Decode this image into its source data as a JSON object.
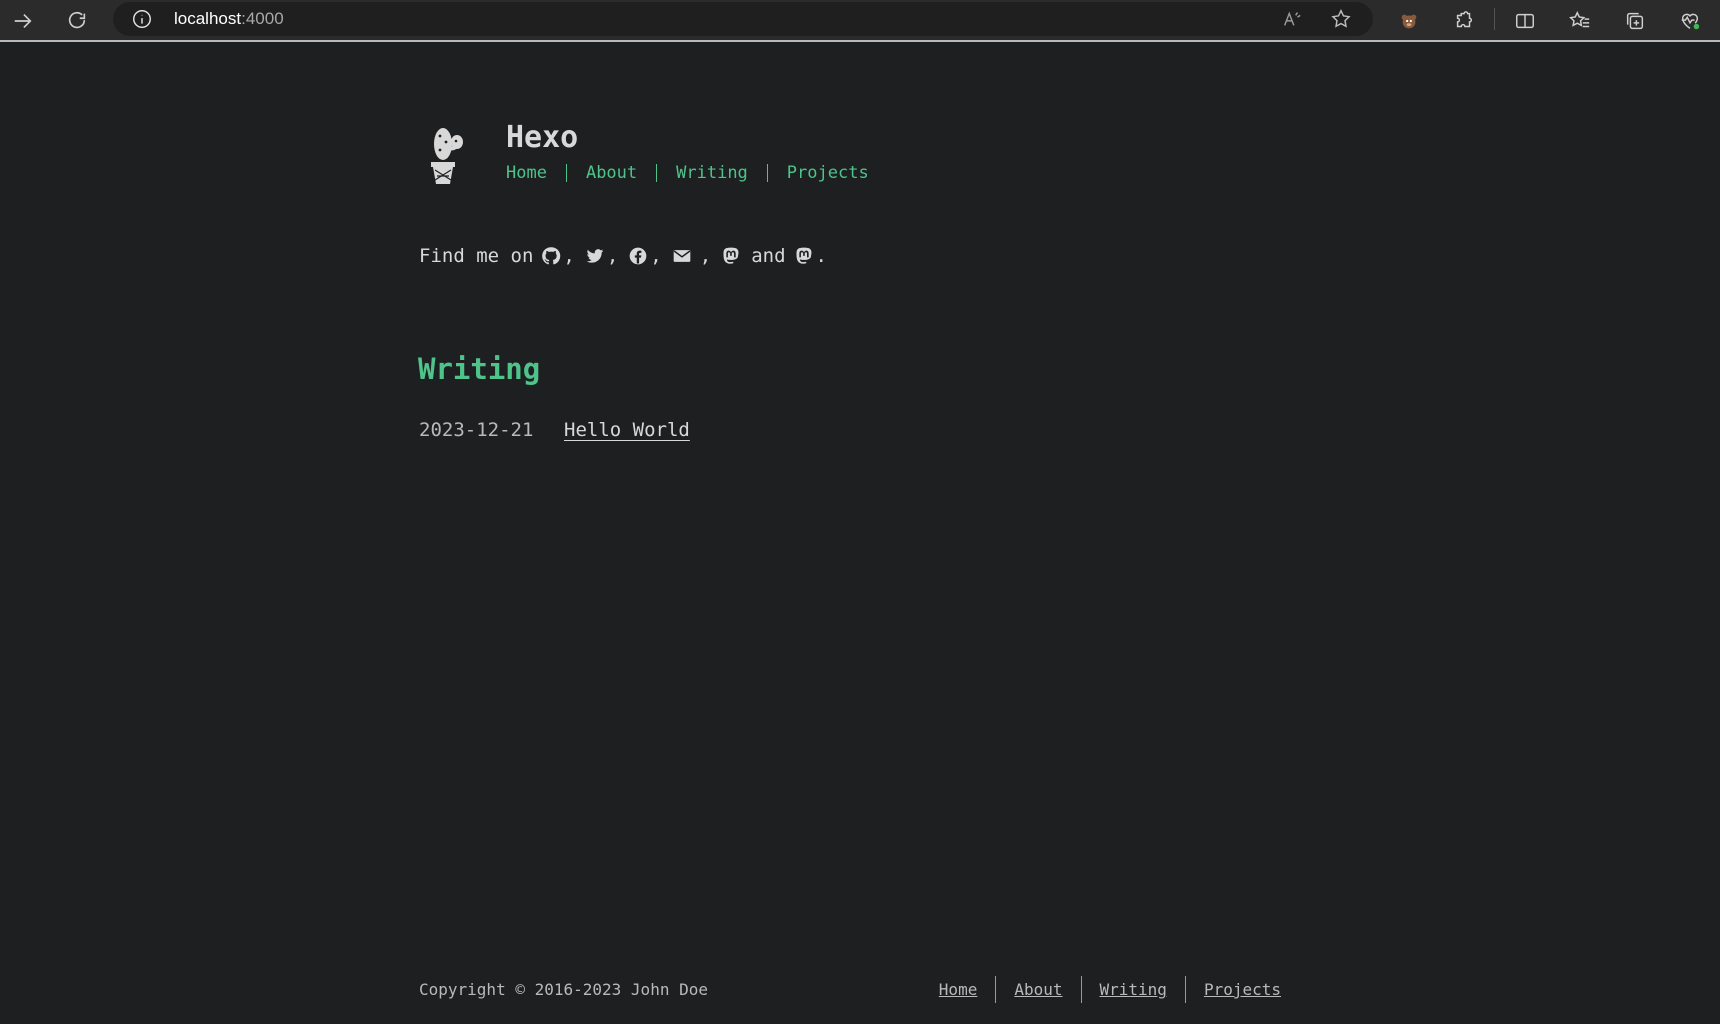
{
  "browser": {
    "url_host": "localhost",
    "url_port": ":4000"
  },
  "site": {
    "title": "Hexo",
    "nav": [
      "Home",
      "About",
      "Writing",
      "Projects"
    ]
  },
  "intro": {
    "prefix": "Find me on",
    "comma": ",",
    "and": "and",
    "period": ".",
    "icons": [
      "github-icon",
      "twitter-icon",
      "facebook-icon",
      "mail-icon",
      "mastodon-icon",
      "mastodon-icon"
    ]
  },
  "writing": {
    "heading": "Writing",
    "posts": [
      {
        "date": "2023-12-21",
        "title": "Hello World"
      }
    ]
  },
  "footer": {
    "copyright": "Copyright © 2016-2023 John Doe",
    "nav": [
      "Home",
      "About",
      "Writing",
      "Projects"
    ]
  },
  "colors": {
    "accent": "#4ec48a",
    "background": "#1d1f21"
  }
}
